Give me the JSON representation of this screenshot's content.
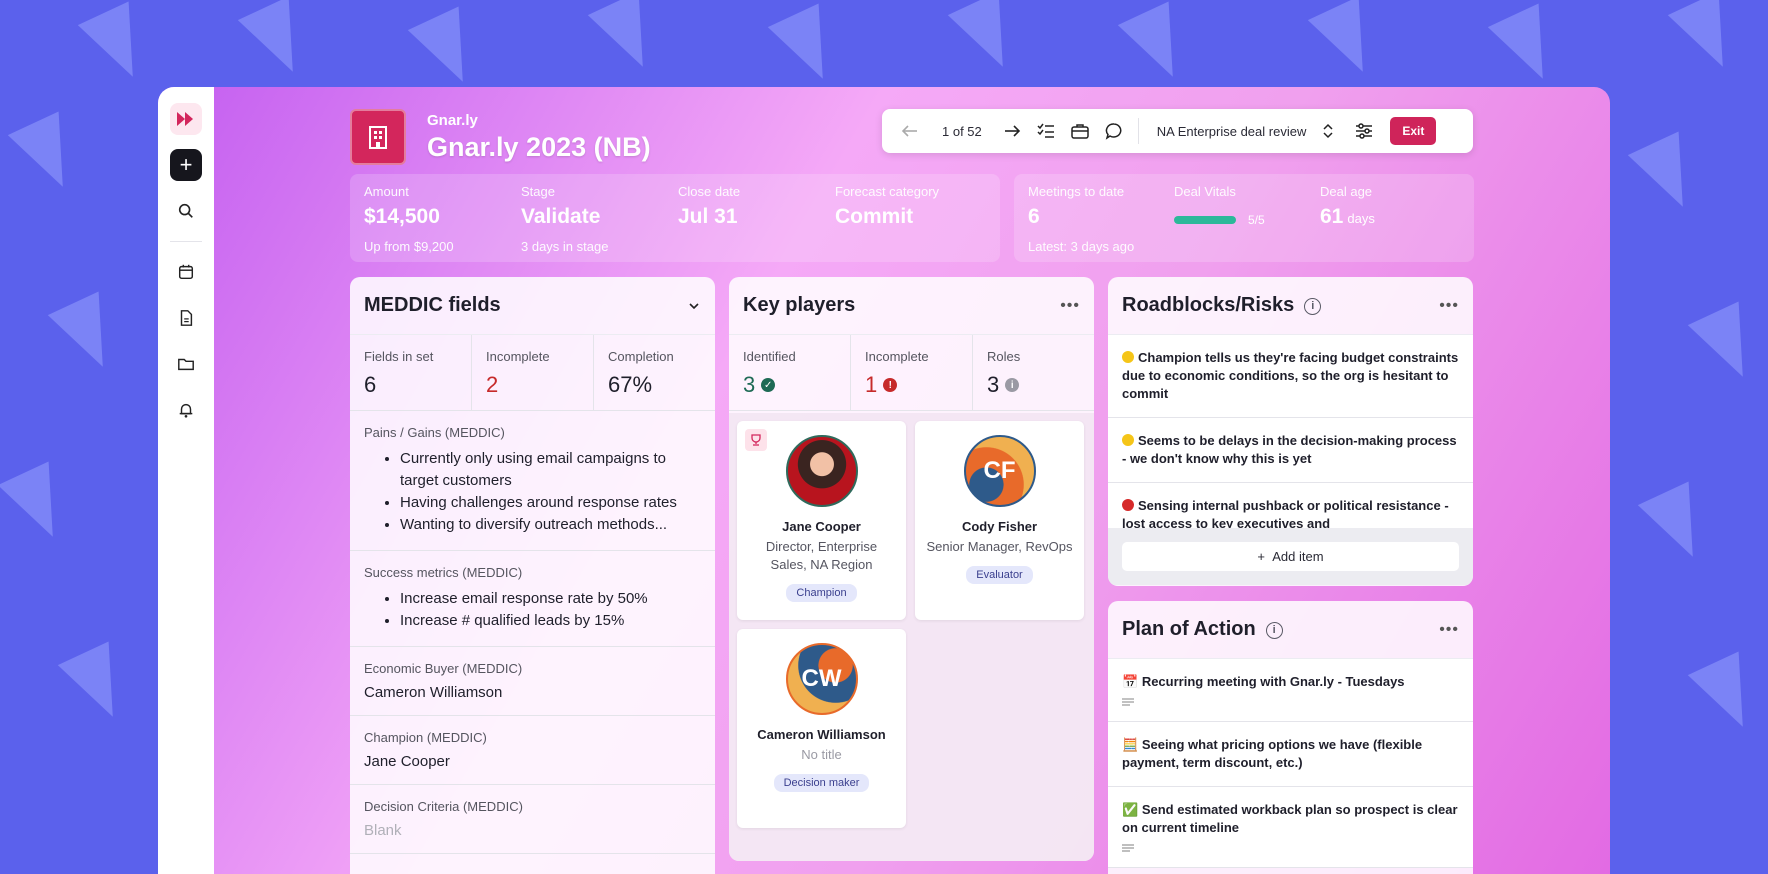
{
  "header": {
    "company": "Gnar.ly",
    "deal_title": "Gnar.ly 2023 (NB)"
  },
  "toolbar": {
    "counter": "1 of 52",
    "review_name": "NA Enterprise deal review",
    "exit_label": "Exit"
  },
  "deal_stats": {
    "amount": {
      "label": "Amount",
      "value": "$14,500",
      "sub": "Up from $9,200"
    },
    "stage": {
      "label": "Stage",
      "value": "Validate",
      "sub": "3 days in stage"
    },
    "close_date": {
      "label": "Close date",
      "value": "Jul 31"
    },
    "forecast": {
      "label": "Forecast category",
      "value": "Commit"
    }
  },
  "engagement": {
    "meetings": {
      "label": "Meetings to date",
      "value": "6",
      "sub": "Latest: 3 days ago"
    },
    "vitals": {
      "label": "Deal Vitals",
      "text": "5/5",
      "fraction": 1.0
    },
    "age": {
      "label": "Deal age",
      "value": "61",
      "unit": "days"
    }
  },
  "meddic": {
    "title": "MEDDIC fields",
    "metrics": [
      {
        "label": "Fields in set",
        "value": "6"
      },
      {
        "label": "Incomplete",
        "value": "2"
      },
      {
        "label": "Completion",
        "value": "67%"
      }
    ],
    "pains": {
      "label": "Pains / Gains (MEDDIC)",
      "items": [
        "Currently only using email campaigns to target customers",
        "Having challenges around response rates",
        "Wanting to diversify outreach methods..."
      ]
    },
    "success": {
      "label": "Success metrics (MEDDIC)",
      "items": [
        "Increase email response rate by 50%",
        "Increase # qualified leads by 15%"
      ]
    },
    "economic_buyer": {
      "label": "Economic Buyer (MEDDIC)",
      "value": "Cameron Williamson"
    },
    "champion": {
      "label": "Champion (MEDDIC)",
      "value": "Jane Cooper"
    },
    "decision_criteria": {
      "label": "Decision Criteria (MEDDIC)",
      "value": "Blank"
    }
  },
  "key_players": {
    "title": "Key players",
    "metrics": [
      {
        "label": "Identified",
        "value": "3"
      },
      {
        "label": "Incomplete",
        "value": "1"
      },
      {
        "label": "Roles",
        "value": "3"
      }
    ],
    "players": [
      {
        "name": "Jane Cooper",
        "title": "Director, Enterprise Sales, NA Region",
        "role": "Champion",
        "initials": ""
      },
      {
        "name": "Cody Fisher",
        "title": "Senior Manager, RevOps",
        "role": "Evaluator",
        "initials": "CF"
      },
      {
        "name": "Cameron Williamson",
        "title": "No title",
        "role": "Decision maker",
        "initials": "CW"
      }
    ]
  },
  "risks": {
    "title": "Roadblocks/Risks",
    "items": [
      {
        "text": "Champion tells us they're facing budget constraints due to economic conditions, so the org is hesitant to commit",
        "color": "#f5c518"
      },
      {
        "text": "Seems to be delays in the decision-making process - we don't know why this is yet",
        "color": "#f5c518"
      },
      {
        "text": "Sensing internal pushback or political resistance - lost access to key executives and",
        "color": "#d62a2a"
      }
    ],
    "add_label": "Add item"
  },
  "plan": {
    "title": "Plan of Action",
    "items": [
      {
        "text": "Recurring meeting with Gnar.ly - Tuesdays",
        "icon": "calendar-icon"
      },
      {
        "text": "Seeing what pricing options we have (flexible payment, term discount, etc.)",
        "icon": "abacus-icon"
      },
      {
        "text": "Send estimated workback plan so prospect is clear on current timeline",
        "icon": "check-icon"
      }
    ]
  }
}
